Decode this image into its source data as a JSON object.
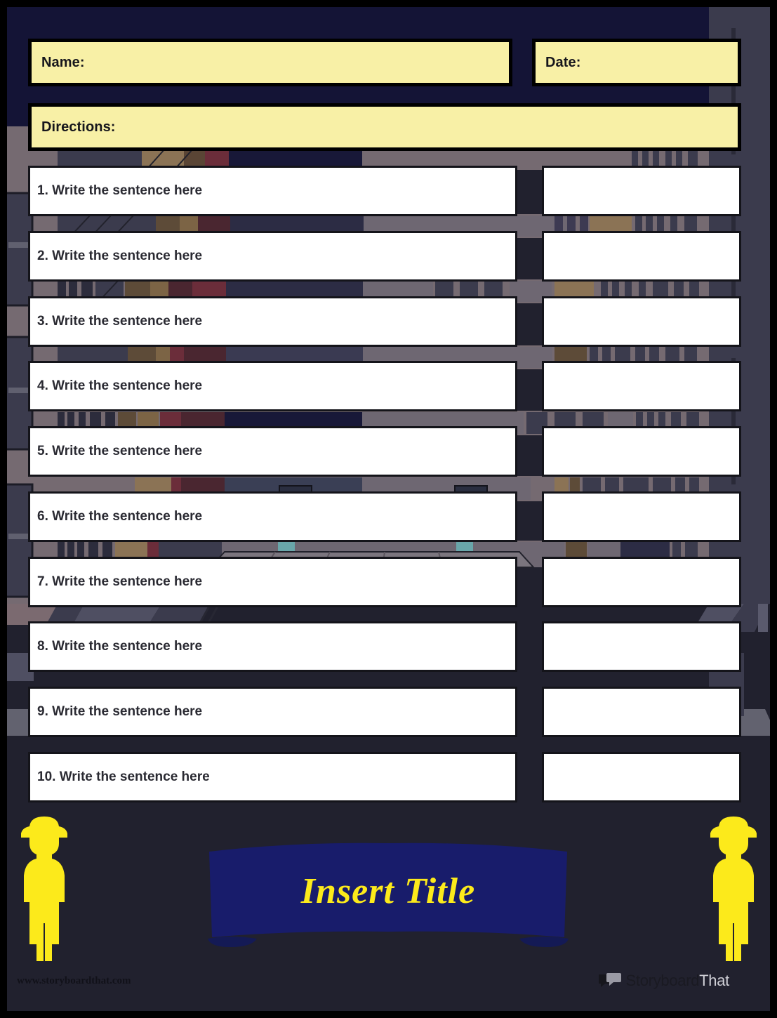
{
  "page": {
    "background_color": "#21212e",
    "frame_color": "#000000",
    "field_color": "#f8f0a6",
    "banner_color": "#181c6b",
    "accent_yellow": "#fcea1b",
    "box_color": "#ffffff"
  },
  "header": {
    "name_label": "Name:",
    "date_label": "Date:",
    "directions_label": "Directions:"
  },
  "rows": [
    {
      "sentence": "1. Write the sentence here"
    },
    {
      "sentence": "2. Write the sentence here"
    },
    {
      "sentence": "3. Write the sentence here"
    },
    {
      "sentence": "4. Write the sentence here"
    },
    {
      "sentence": "5. Write the sentence here"
    },
    {
      "sentence": "6. Write the sentence here"
    },
    {
      "sentence": "7. Write the sentence here"
    },
    {
      "sentence": "8. Write the sentence here"
    },
    {
      "sentence": "9. Write the sentence here"
    },
    {
      "sentence": "10. Write the sentence here"
    }
  ],
  "title": {
    "text": "Insert Title"
  },
  "footer": {
    "url": "www.storyboardthat.com",
    "logo_primary": "Storyboard",
    "logo_secondary": "That"
  }
}
